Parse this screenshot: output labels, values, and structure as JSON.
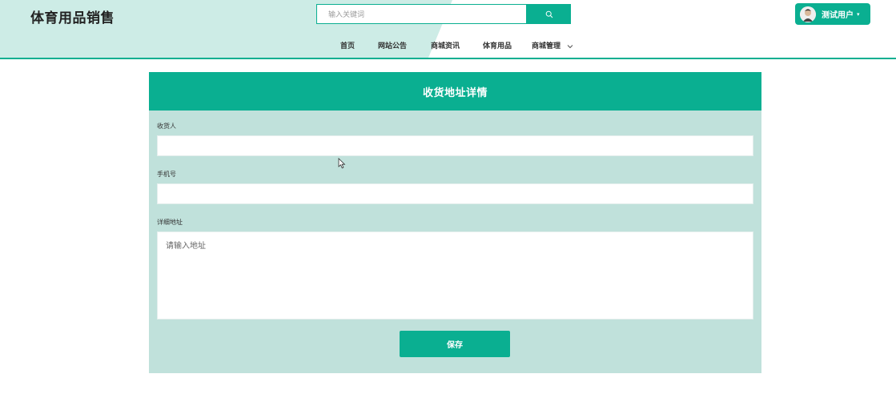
{
  "site": {
    "title": "体育用品销售"
  },
  "search": {
    "placeholder": "输入关键词",
    "button_icon": "search-icon"
  },
  "user": {
    "name": "测试用户",
    "caret": "▾",
    "avatar_icon": "avatar-icon"
  },
  "nav": {
    "items": [
      {
        "label": "首页"
      },
      {
        "label": "网站公告"
      },
      {
        "label": "商城资讯"
      },
      {
        "label": "体育用品"
      },
      {
        "label": "商城管理",
        "has_dropdown": true
      }
    ]
  },
  "form": {
    "title": "收货地址详情",
    "fields": [
      {
        "label": "收货人",
        "value": ""
      },
      {
        "label": "手机号",
        "value": ""
      },
      {
        "label": "详细地址",
        "value": "",
        "placeholder": "请输入地址"
      }
    ],
    "save_label": "保存"
  },
  "colors": {
    "accent": "#0aaf91",
    "card_bg": "#c0e1db",
    "header_tint": "#cdece6"
  }
}
